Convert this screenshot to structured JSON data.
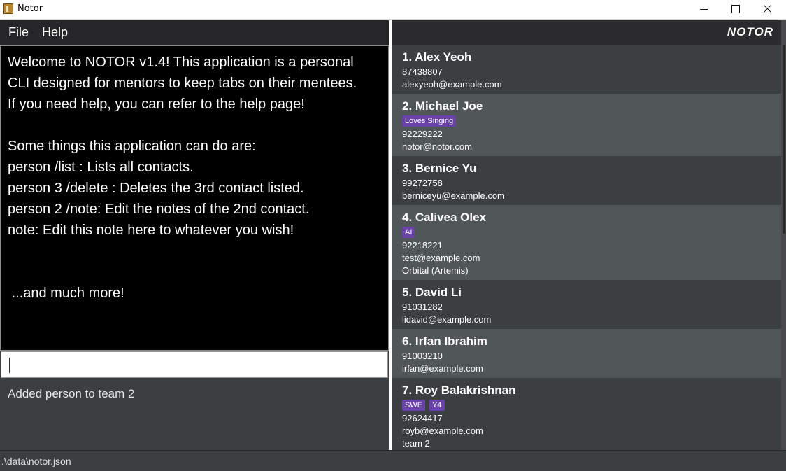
{
  "window": {
    "title": "Notor",
    "icon": "notor-app-icon"
  },
  "menu": {
    "file": "File",
    "help": "Help"
  },
  "brand": "NOTOR",
  "result_display": {
    "lines": [
      "Welcome to NOTOR v1.4! This application is a personal",
      "CLI designed for mentors to keep tabs on their mentees.",
      "If you need help, you can refer to the help page!",
      "",
      "Some things this application can do are:",
      "person /list : Lists all contacts.",
      "person 3 /delete : Deletes the 3rd contact listed.",
      "person 2 /note: Edit the notes of the 2nd contact.",
      "note: Edit this note here to whatever you wish!",
      "",
      "",
      " ...and much more!"
    ]
  },
  "command_box": {
    "value": ""
  },
  "feedback": "Added person to team 2",
  "persons": [
    {
      "name": "1.  Alex Yeoh",
      "tags": [],
      "lines": [
        "87438807",
        "alexyeoh@example.com"
      ]
    },
    {
      "name": "2.  Michael Joe",
      "tags": [
        "Loves Singing"
      ],
      "lines": [
        "92229222",
        "notor@notor.com"
      ]
    },
    {
      "name": "3.  Bernice Yu",
      "tags": [],
      "lines": [
        "99272758",
        "berniceyu@example.com"
      ]
    },
    {
      "name": "4.  Calivea Olex",
      "tags": [
        "AI"
      ],
      "lines": [
        "92218221",
        "test@example.com",
        "Orbital (Artemis)"
      ]
    },
    {
      "name": "5.  David Li",
      "tags": [],
      "lines": [
        "91031282",
        "lidavid@example.com"
      ]
    },
    {
      "name": "6.  Irfan Ibrahim",
      "tags": [],
      "lines": [
        "91003210",
        "irfan@example.com"
      ]
    },
    {
      "name": "7.  Roy Balakrishnan",
      "tags": [
        "SWE",
        "Y4"
      ],
      "lines": [
        "92624417",
        "royb@example.com",
        "team 2"
      ]
    }
  ],
  "status_bar": {
    "path": ".\\data\\notor.json"
  },
  "colors": {
    "tag": "#6a43a8",
    "result_bg": "#000000",
    "panel_bg": "#3c3f41",
    "card_alt_bg": "#515658"
  }
}
